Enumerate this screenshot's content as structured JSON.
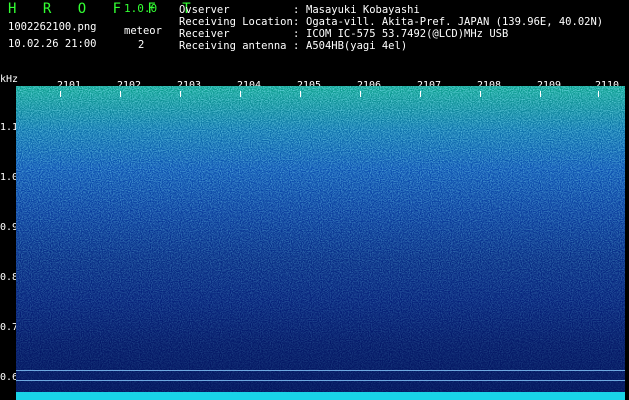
{
  "header": {
    "app_name": "H R O F F T",
    "app_version": "1.0.0",
    "file_name": "1002262100.png",
    "datetime": "10.02.26 21:00",
    "meteor_label": "meteor",
    "meteor_count": "2",
    "rows": [
      {
        "label": "Ovserver",
        "sep": ":",
        "value": "Masayuki Kobayashi"
      },
      {
        "label": "Receiving Location",
        "sep": ":",
        "value": "Ogata-vill. Akita-Pref. JAPAN (139.96E, 40.02N)"
      },
      {
        "label": "Receiver",
        "sep": ":",
        "value": "ICOM IC-575 53.7492(@LCD)MHz USB"
      },
      {
        "label": "Receiving antenna",
        "sep": ":",
        "value": "A504HB(yagi 4el)"
      }
    ]
  },
  "axis": {
    "y_unit": "kHz",
    "y_ticks": [
      "1.1",
      "1.0",
      "0.9",
      "0.8",
      "0.7",
      "0.6"
    ],
    "x_ticks": [
      "2101",
      "2102",
      "2103",
      "2104",
      "2105",
      "2106",
      "2107",
      "2108",
      "2109",
      "2110"
    ]
  },
  "colors": {
    "header_green": "#33ff33",
    "baseline": "#19d4e8"
  }
}
